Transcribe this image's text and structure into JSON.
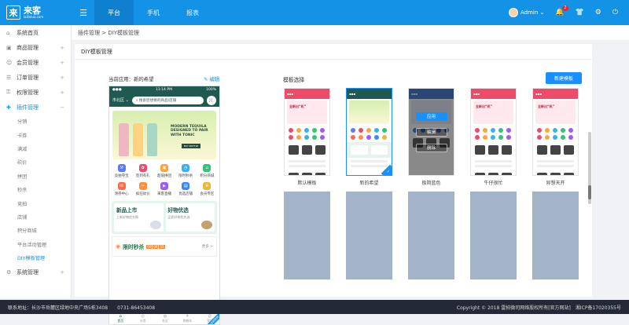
{
  "brand": {
    "main": "来客",
    "sub": "laikeluo.com",
    "logo_char": "来"
  },
  "topnav": [
    "平台",
    "手机",
    "报表"
  ],
  "user": {
    "name": "Admin",
    "notify_count": "2"
  },
  "sidebar": {
    "items": [
      "系统首页",
      "商品管理",
      "会员管理",
      "订单管理",
      "权限管理",
      "插件管理"
    ],
    "sub_items": [
      "分销",
      "卡券",
      "满减",
      "砍价",
      "拼团",
      "秒杀",
      "竞拍",
      "店铺",
      "积分商城",
      "平台活动管理",
      "DIY模板管理"
    ],
    "last_item": "系统管理"
  },
  "breadcrumb": "插件管理 > DIY模板管理",
  "panel_title": "DIY模板管理",
  "current": {
    "label": "当前应用：新的希望",
    "edit": "编辑"
  },
  "phone": {
    "time": "11:14 PM",
    "battery": "100%",
    "city": "市北区",
    "search_placeholder": "搜索您想要的商品/店铺",
    "banner_text": "MODERN TEQUILA DESIGNED TO PAIR WITH TONIC",
    "banner_btn": "BUY BOTTLE",
    "grid": [
      "竞拍夺宝",
      "签到有礼",
      "超值拼团",
      "限时秒杀",
      "积分商城",
      "领券中心",
      "疯狂砍价",
      "来客直播",
      "优选店铺",
      "会员专区"
    ],
    "promo": [
      {
        "title": "新品上市",
        "sub": "上新好物优先购"
      },
      {
        "title": "好物优选",
        "sub": "品质好物优先选"
      }
    ],
    "flash": {
      "title": "限时秒杀",
      "time": [
        "00",
        "08",
        "55"
      ],
      "more": "更多 >"
    },
    "tabs": [
      "首页",
      "分类",
      "社区",
      "购物车",
      "我的"
    ],
    "ribbon": "当前使用"
  },
  "templates": {
    "label": "模板选择",
    "new_button": "新建模板",
    "names": [
      "默认模板",
      "新的希望",
      "极简蓝色",
      "牛仔很忙",
      "异想天开"
    ],
    "overlay": {
      "apply": "应用",
      "edit": "编辑",
      "delete": "删除"
    },
    "thumb_title": "全新出“机”"
  },
  "footer": {
    "left": "联系地址：长沙市岳麓区绿地中央广场5栋3408　　0731-86453408",
    "right": "Copyright © 2018 雷拍微司网络股权所有[官方网站]　湘ICP备17020355号"
  }
}
